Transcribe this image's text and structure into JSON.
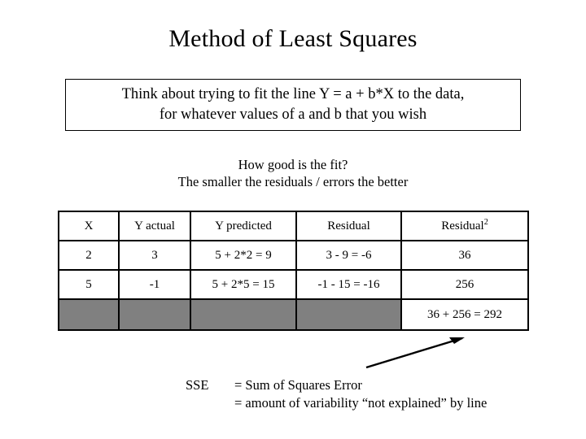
{
  "slide": {
    "title": "Method of Least Squares",
    "statement": {
      "line1": "Think about trying to fit the line Y = a + b*X to the data,",
      "line2": "for whatever values of a and b that you wish"
    },
    "fit_question": {
      "line1": "How good is the fit?",
      "line2": "The smaller the residuals / errors the better"
    },
    "table": {
      "headers": {
        "x": "X",
        "y_actual": "Y actual",
        "y_predicted": "Y predicted",
        "residual": "Residual",
        "residual_squared_base": "Residual",
        "residual_squared_exp": "2"
      },
      "rows": [
        {
          "x": "2",
          "y_actual": "3",
          "y_predicted": "5 + 2*2 = 9",
          "residual": "3 - 9 = -6",
          "residual_squared": "36"
        },
        {
          "x": "5",
          "y_actual": "-1",
          "y_predicted": "5 + 2*5 = 15",
          "residual": "-1 - 15 = -16",
          "residual_squared": "256"
        }
      ],
      "total_row": {
        "x": "",
        "y_actual": "",
        "y_predicted": "",
        "residual": "",
        "sum": "36 + 256 = 292"
      }
    },
    "sse": {
      "label": "SSE",
      "definition1": "= Sum of Squares Error",
      "definition2": "= amount of variability “not explained” by line"
    },
    "colors": {
      "filled_cell": "#808080",
      "border": "#000000",
      "text": "#000000",
      "background": "#ffffff"
    }
  }
}
